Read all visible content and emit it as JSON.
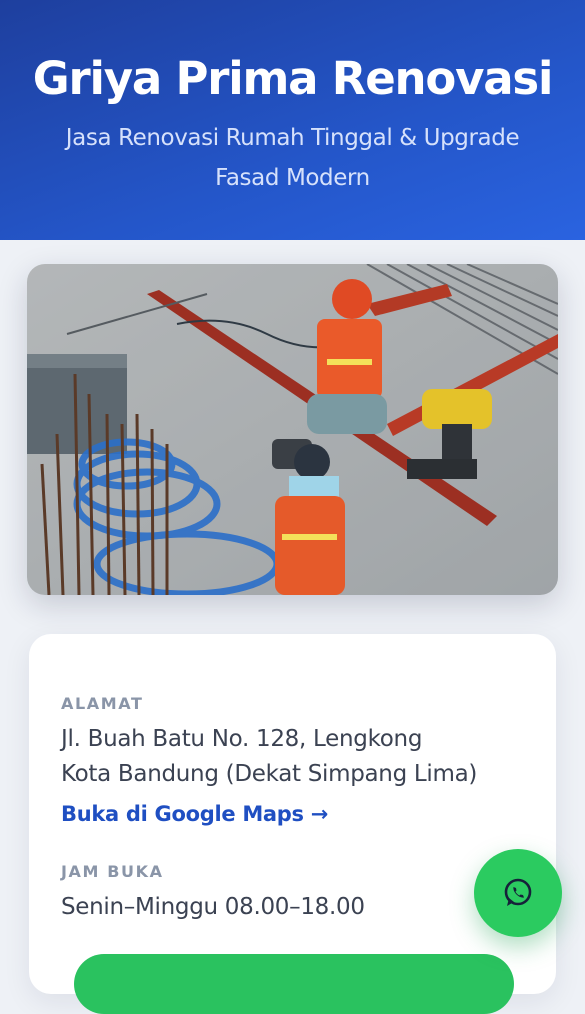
{
  "hero": {
    "title": "Griya Prima Renovasi",
    "subtitle": "Jasa Renovasi Rumah Tinggal & Upgrade Fasad Modern"
  },
  "photo": {
    "subject": "construction-workers"
  },
  "info": {
    "address_label": "ALAMAT",
    "address_line1": "Jl. Buah Batu No. 128, Lengkong",
    "address_line2": "Kota Bandung (Dekat Simpang Lima)",
    "maps_link": "Buka di Google Maps →",
    "hours_label": "JAM BUKA",
    "hours_value": "Senin–Minggu 08.00–18.00"
  },
  "whatsapp": {
    "icon": "whatsapp-icon",
    "color": "#2bcb60"
  },
  "colors": {
    "hero_start": "#1e3f9e",
    "hero_end": "#2a63e0",
    "link": "#1f4fc2",
    "accent_green": "#2ac25f"
  }
}
